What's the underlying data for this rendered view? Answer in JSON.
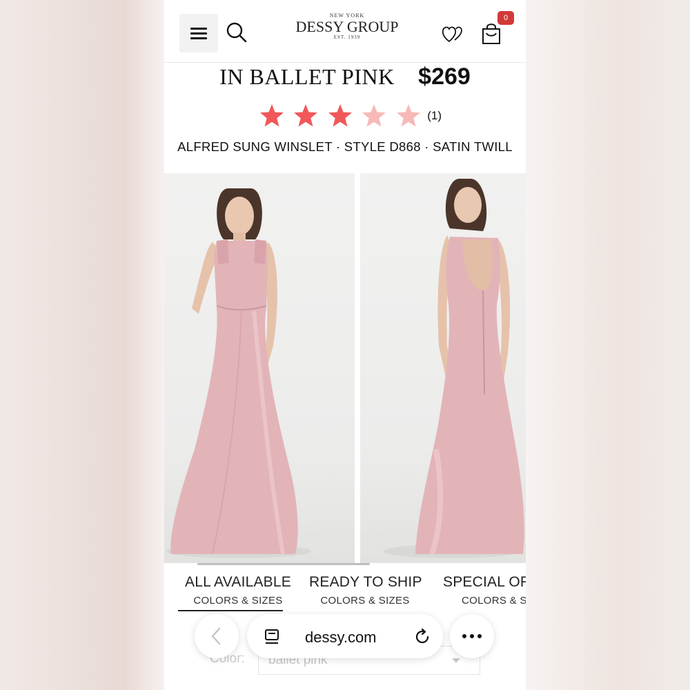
{
  "header": {
    "logo_top": "NEW YORK",
    "logo_name": "DESSY GROUP",
    "logo_est": "EST. 1939",
    "cart_count": "0"
  },
  "product": {
    "color_title": "IN BALLET PINK",
    "price": "$269",
    "rating": 3,
    "rating_max": 5,
    "rating_count": "(1)",
    "subtitle": "ALFRED SUNG WINSLET · STYLE D868 · SATIN TWILL"
  },
  "tabs": [
    {
      "title": "ALL AVAILABLE",
      "sub": "COLORS & SIZES"
    },
    {
      "title": "READY TO SHIP",
      "sub": "COLORS & SIZES"
    },
    {
      "title": "SPECIAL OF",
      "sub": "COLORS & SI"
    }
  ],
  "color_field": {
    "label": "Color:",
    "value": "ballet pink"
  },
  "browser": {
    "url": "dessy.com"
  },
  "colors": {
    "star_filled": "#f0585a",
    "star_faded": "#f7b9b8",
    "dress": "#e2b4b8"
  }
}
